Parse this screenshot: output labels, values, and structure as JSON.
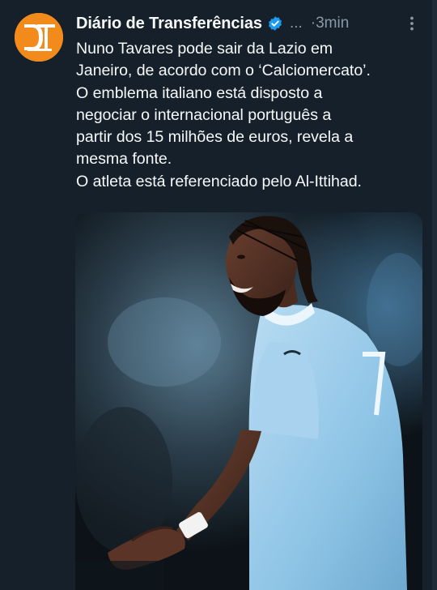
{
  "tweet": {
    "author_name": "Diário de Transferências",
    "handle_truncated": "...",
    "separator": "·",
    "timestamp": "3min",
    "avatar": {
      "initials_icon": "dt-logo-icon",
      "bg_color": "#f28a1c"
    },
    "verified_icon": "verified-badge-icon",
    "more_icon": "more-vertical-icon",
    "text_lines": [
      "Nuno Tavares pode sair da Lazio em",
      "Janeiro, de acordo com o ‘Calciomercato’.",
      "O emblema italiano está disposto a",
      "negociar o internacional português a",
      "partir dos 15 milhões de euros, revela a",
      "mesma fonte.",
      "O atleta está referenciado pelo Al-Ittihad."
    ],
    "media": {
      "type": "photo",
      "subject": "football-player-photo"
    }
  },
  "colors": {
    "background": "#15202b",
    "text_primary": "#f7f9f9",
    "text_secondary": "#8b98a5",
    "verified": "#1d9bf0",
    "avatar_brand": "#f28a1c"
  }
}
